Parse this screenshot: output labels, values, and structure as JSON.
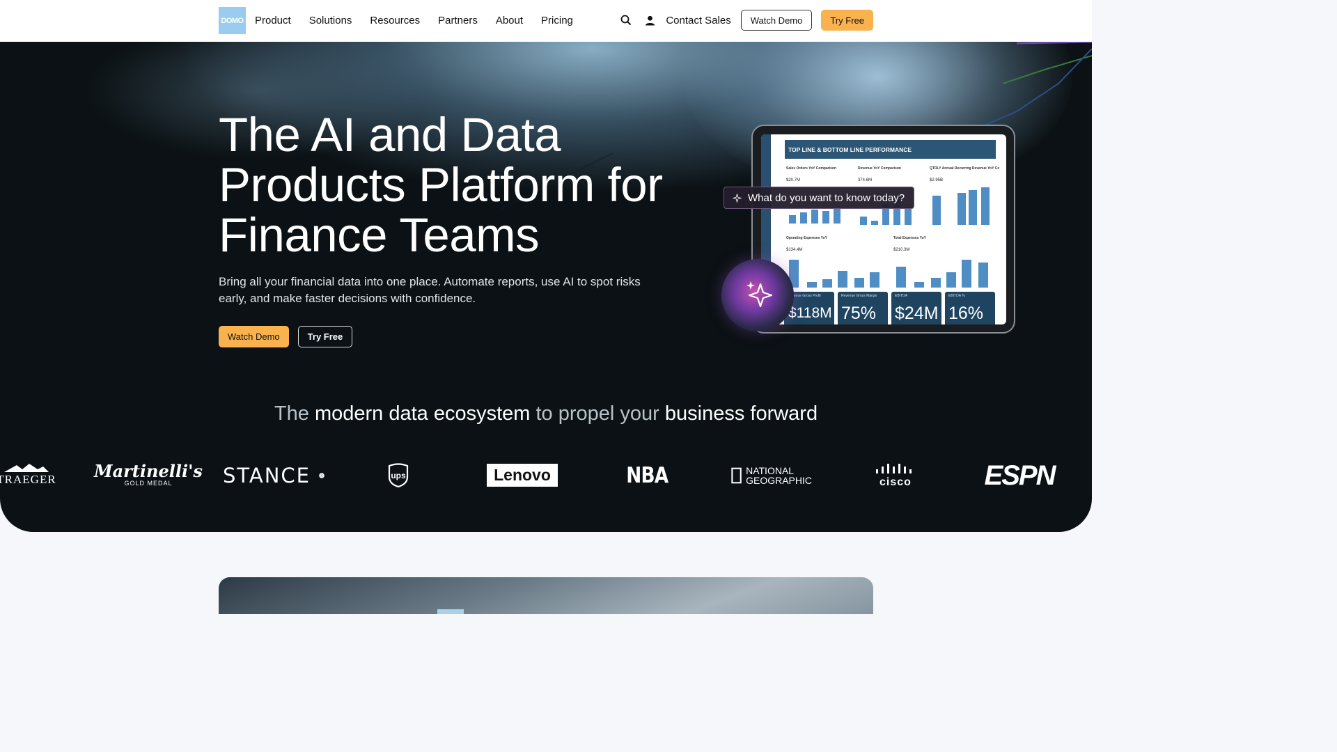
{
  "nav": {
    "logo": "DOMO",
    "links": [
      "Product",
      "Solutions",
      "Resources",
      "Partners",
      "About",
      "Pricing"
    ],
    "contact": "Contact Sales",
    "watch_demo": "Watch Demo",
    "try_free": "Try Free"
  },
  "hero": {
    "headline": "The AI and Data Products Platform for Finance Teams",
    "subtext": "Bring all your financial data into one place. Automate reports, use AI to spot risks early, and make faster decisions with confidence.",
    "watch_demo": "Watch Demo",
    "try_free": "Try Free",
    "ai_prompt": "What do you want to know today?"
  },
  "dashboard": {
    "title": "TOP LINE & BOTTOM LINE PERFORMANCE",
    "panels": [
      {
        "label": "Sales Orders YoY Comparison",
        "value": "$20.7M"
      },
      {
        "label": "Revenue YoY Comparison",
        "value": "374.6M"
      },
      {
        "label": "QTRLY Annual Recurring Revenue YoY Comps",
        "value": "$2.95B"
      },
      {
        "label": "Operating Expenses YoY",
        "value": "$134.4M"
      },
      {
        "label": "Total Expenses YoY",
        "value": "$210.3M"
      }
    ],
    "kpis": [
      {
        "label": "Revenue Gross Profit",
        "value": "$118M"
      },
      {
        "label": "Revenue Gross Margin",
        "value": "75%"
      },
      {
        "label": "EBITDA",
        "value": "$24M"
      },
      {
        "label": "EBITDA %",
        "value": "16%"
      }
    ]
  },
  "ecosystem": {
    "part1": "The",
    "part2": "modern data ecosystem",
    "part3": "to propel your",
    "part4": "business forward"
  },
  "brands": [
    "TRAEGER",
    "Martinelli's",
    "GOLD MEDAL",
    "STANCE",
    "ups",
    "Lenovo",
    "NBA",
    "NATIONAL",
    "GEOGRAPHIC",
    "cisco",
    "ESPN"
  ]
}
